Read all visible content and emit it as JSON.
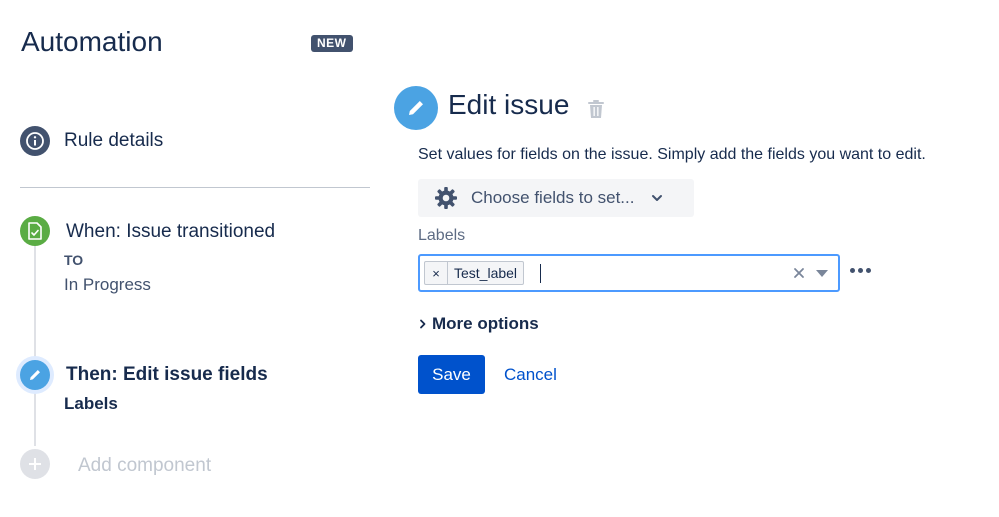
{
  "app": {
    "title": "Automation",
    "badge": "NEW"
  },
  "sidebar": {
    "rule_details": "Rule details",
    "trigger": {
      "title": "When: Issue transitioned",
      "to_label": "TO",
      "to_value": "In Progress"
    },
    "action": {
      "title": "Then: Edit issue fields",
      "subtitle": "Labels"
    },
    "add_component": "Add component"
  },
  "editor": {
    "title": "Edit issue",
    "helper": "Set values for fields on the issue. Simply add the fields you want to edit.",
    "choose_fields_label": "Choose fields to set...",
    "field_label": "Labels",
    "tags": [
      "Test_label"
    ],
    "tag_remove_glyph": "×",
    "more_options": "More options",
    "save_label": "Save",
    "cancel_label": "Cancel"
  },
  "icons": {
    "info": "info-icon",
    "trigger": "document-transition-icon",
    "edit": "pencil-icon",
    "add": "plus-icon",
    "trash": "trash-icon",
    "gear": "gear-icon",
    "chevron_down": "chevron-down-icon",
    "chevron_right": "chevron-right-icon",
    "clear": "clear-icon",
    "dropdown": "dropdown-arrow-icon",
    "more": "more-icon"
  },
  "colors": {
    "primary": "#0052cc",
    "trigger_green": "#5aac44",
    "action_blue": "#4ba3e3",
    "text_dark": "#172b4d",
    "muted": "#42526e"
  }
}
